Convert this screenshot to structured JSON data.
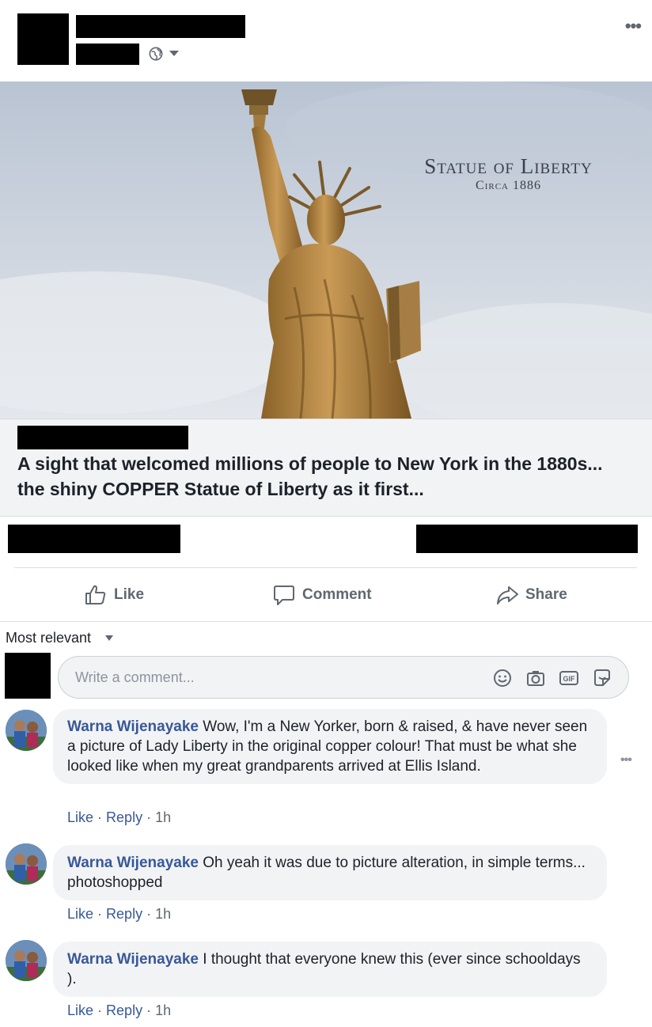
{
  "post": {
    "more_menu": "•••",
    "photo_title": "Statue of Liberty",
    "photo_subtitle": "Circa 1886",
    "link_headline": "A sight that welcomed millions of people to New York in the 1880s... the shiny COPPER Statue of Liberty as it first..."
  },
  "actions": {
    "like": "Like",
    "comment": "Comment",
    "share": "Share"
  },
  "comments_section": {
    "sort_label": "Most relevant",
    "input_placeholder": "Write a comment..."
  },
  "comments": [
    {
      "author": "Warna Wijenayake",
      "text": "Wow, I'm a New Yorker, born & raised, & have never seen a picture of Lady Liberty in the original copper colour! That must be what she looked like when my great grandparents arrived at Ellis Island.",
      "like": "Like",
      "reply": "Reply",
      "time": "1h",
      "more": "•••"
    },
    {
      "author": "Warna Wijenayake",
      "text": "Oh yeah it was due to picture alteration, in simple terms... photoshopped",
      "like": "Like",
      "reply": "Reply",
      "time": "1h"
    },
    {
      "author": "Warna Wijenayake",
      "text": "I thought that everyone knew this (ever since schooldays ).",
      "like": "Like",
      "reply": "Reply",
      "time": "1h"
    }
  ],
  "colors": {
    "link_blue": "#385898",
    "text_gray": "#606770",
    "bubble_bg": "#f2f3f5",
    "copper_statue": "#b8894a"
  }
}
